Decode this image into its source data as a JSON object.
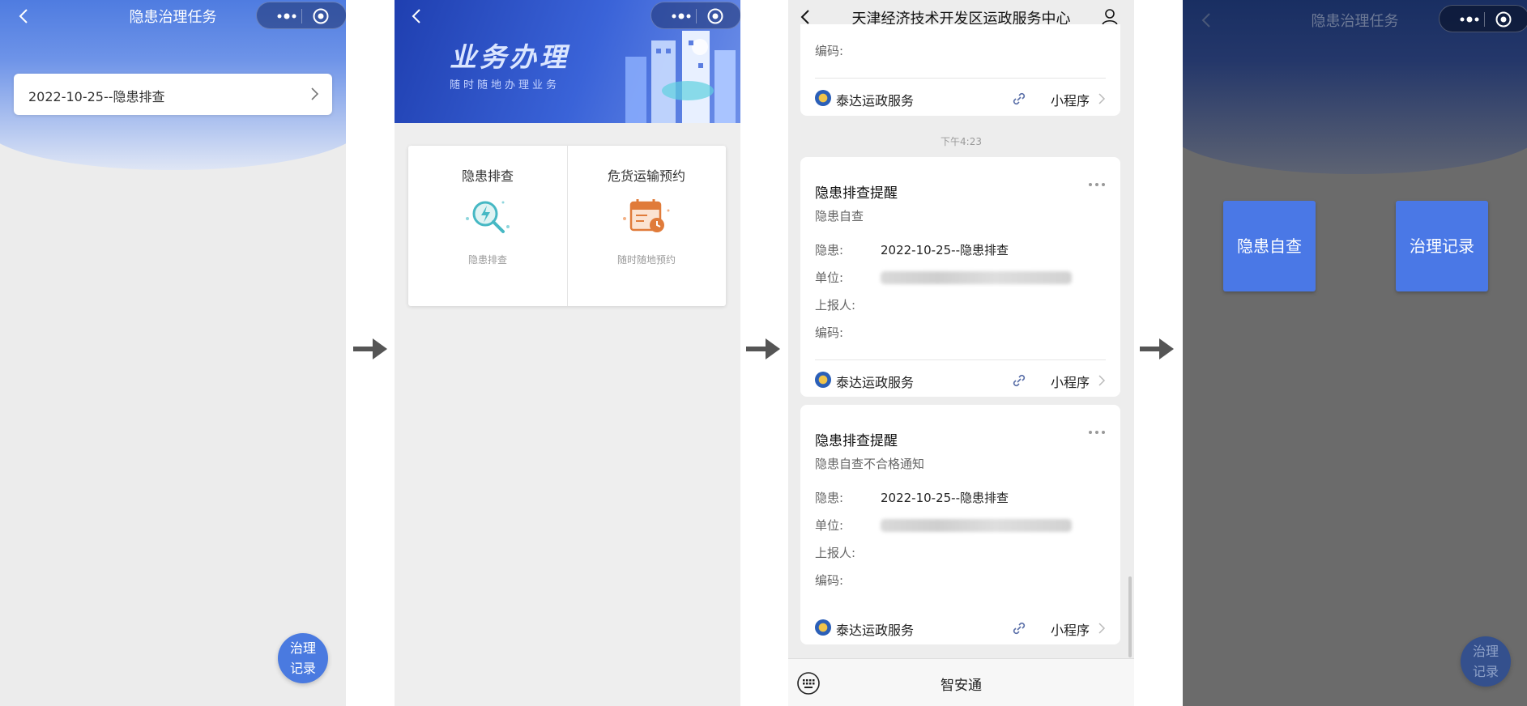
{
  "panel1": {
    "nav_title": "隐患治理任务",
    "task_item": "2022-10-25--隐患排查",
    "fab_line1": "治理",
    "fab_line2": "记录"
  },
  "panel2": {
    "banner_title": "业务办理",
    "banner_subtitle": "随时随地办理业务",
    "services": [
      {
        "name": "隐患排查",
        "desc": "隐患排查",
        "icon": "magnifier-lightning-icon"
      },
      {
        "name": "危货运输预约",
        "desc": "随时随地预约",
        "icon": "calendar-clock-icon"
      }
    ]
  },
  "panel3": {
    "chat_title": "天津经济技术开发区运政服务中心",
    "time": "下午4:23",
    "partial_top": {
      "label_code": "编码:"
    },
    "service_name": "泰达运政服务",
    "mini_program": "小程序",
    "messages": [
      {
        "title": "隐患排查提醒",
        "subtitle": "隐患自查",
        "label_hazard": "隐患:",
        "hazard": "2022-10-25--隐患排查",
        "label_unit": "单位:",
        "label_reporter": "上报人:",
        "label_code": "编码:"
      },
      {
        "title": "隐患排查提醒",
        "subtitle": "隐患自查不合格通知",
        "label_hazard": "隐患:",
        "hazard": "2022-10-25--隐患排查",
        "label_unit": "单位:",
        "label_reporter": "上报人:",
        "label_code": "编码:"
      }
    ],
    "bottom_name": "智安通"
  },
  "panel4": {
    "nav_title": "隐患治理任务",
    "btn_self_check": "隐患自查",
    "btn_records": "治理记录",
    "fab_line1": "治理",
    "fab_line2": "记录"
  },
  "colors": {
    "primary_blue": "#4a7ae0",
    "banner_blue": "#2a4fc4",
    "overlay_gray": "#6b6b6b",
    "arrow": "#555555"
  }
}
